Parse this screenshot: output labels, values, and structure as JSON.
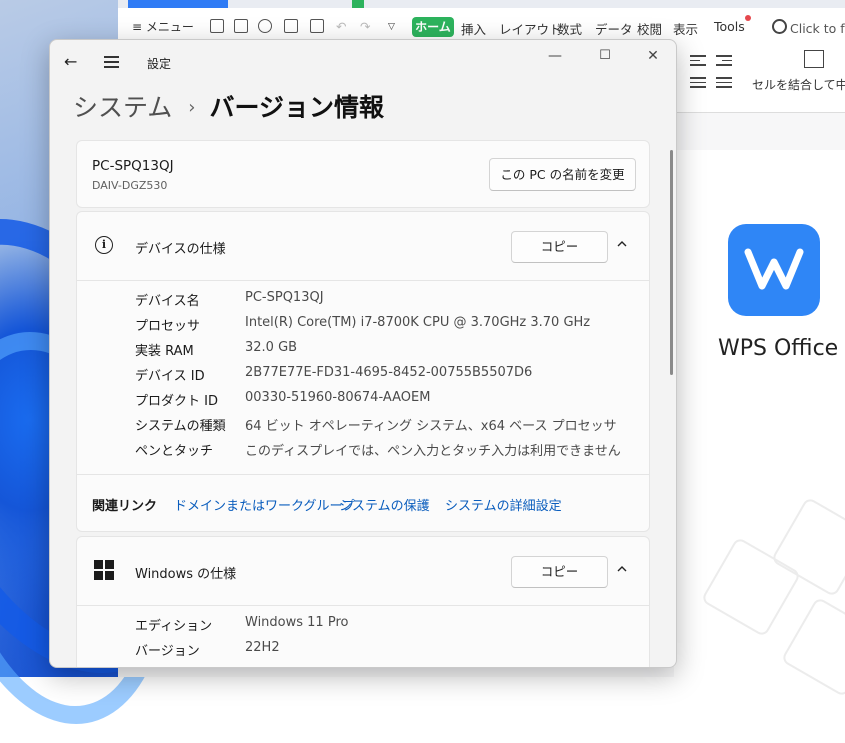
{
  "wps": {
    "menu_label": "≡ メニュー",
    "home_tab": "ホーム",
    "tabs": [
      "挿入",
      "レイアウト",
      "数式",
      "データ",
      "校閲",
      "表示",
      "Tools"
    ],
    "search_placeholder": "Click to f",
    "merge_label": "セルを結合して中央",
    "app_name": "WPS Office",
    "colors": {
      "accent_green": "#2db35d",
      "logo_blue": "#2f86f6"
    }
  },
  "settings": {
    "app_title": "設定",
    "breadcrumb": {
      "parent": "システム",
      "separator": "›",
      "current": "バージョン情報"
    },
    "pc": {
      "name": "PC-SPQ13QJ",
      "model": "DAIV-DGZ530",
      "rename_button": "この PC の名前を変更"
    },
    "device_spec": {
      "title": "デバイスの仕様",
      "copy_button": "コピー",
      "rows": [
        {
          "label": "デバイス名",
          "value": "PC-SPQ13QJ"
        },
        {
          "label": "プロセッサ",
          "value": "Intel(R) Core(TM) i7-8700K CPU @ 3.70GHz   3.70 GHz"
        },
        {
          "label": "実装 RAM",
          "value": "32.0 GB"
        },
        {
          "label": "デバイス ID",
          "value": "2B77E77E-FD31-4695-8452-00755B5507D6"
        },
        {
          "label": "プロダクト ID",
          "value": "00330-51960-80674-AAOEM"
        },
        {
          "label": "システムの種類",
          "value": "64 ビット オペレーティング システム、x64 ベース プロセッサ"
        },
        {
          "label": "ペンとタッチ",
          "value": "このディスプレイでは、ペン入力とタッチ入力は利用できません"
        }
      ]
    },
    "related": {
      "label": "関連リンク",
      "links": [
        "ドメインまたはワークグループ",
        "システムの保護",
        "システムの詳細設定"
      ]
    },
    "windows_spec": {
      "title": "Windows の仕様",
      "copy_button": "コピー",
      "rows": [
        {
          "label": "エディション",
          "value": "Windows 11 Pro"
        },
        {
          "label": "バージョン",
          "value": "22H2"
        }
      ]
    },
    "colors": {
      "link": "#0a5dbd",
      "window_bg": "#f3f3f3",
      "card_bg": "#fbfbfb"
    }
  }
}
